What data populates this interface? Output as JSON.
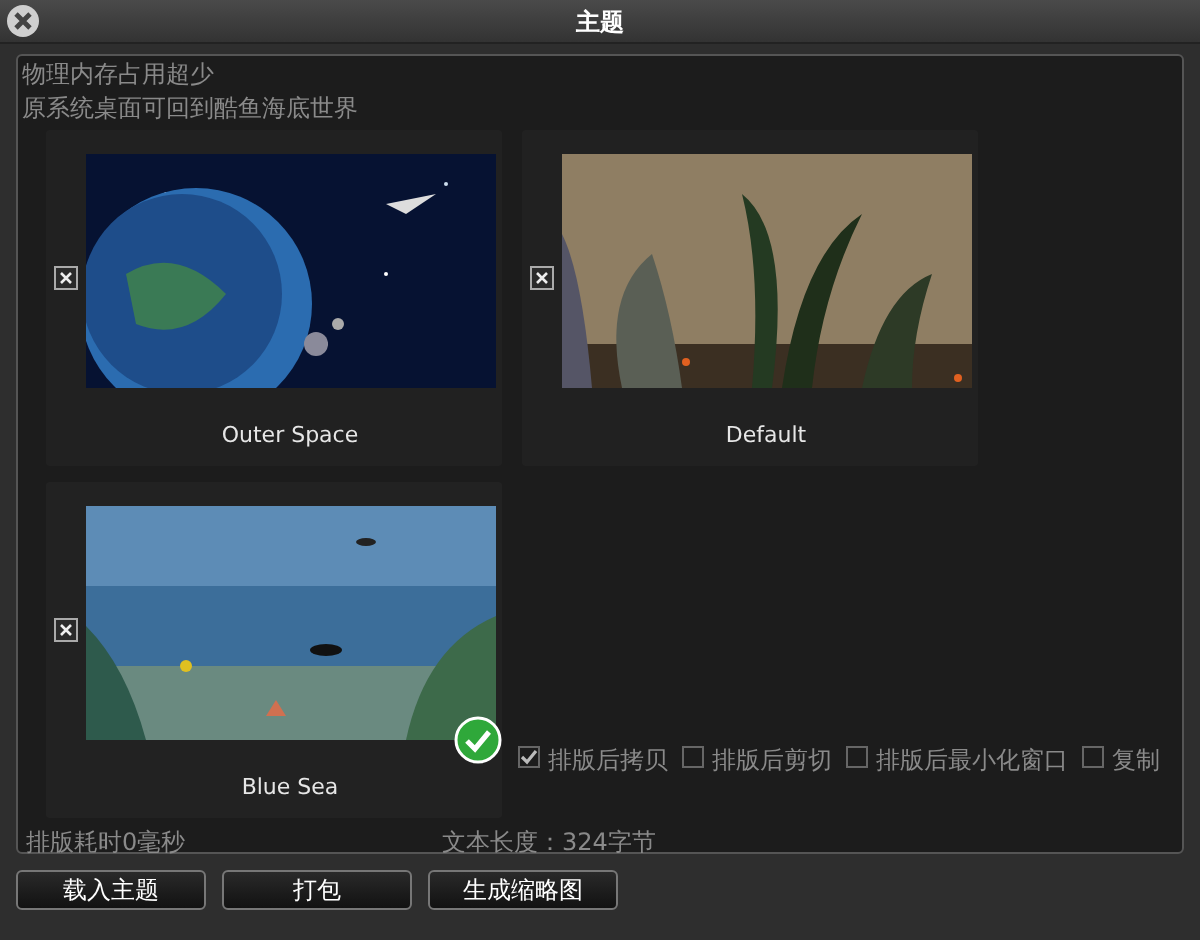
{
  "window": {
    "title": "主题"
  },
  "background_app": {
    "lines": [
      "物理内存占用超少",
      "原系统桌面可回到酷鱼海底世界"
    ],
    "options": [
      {
        "label": "排版后拷贝",
        "checked": true
      },
      {
        "label": "排版后剪切",
        "checked": false
      },
      {
        "label": "排版后最小化窗口",
        "checked": false
      },
      {
        "label": "复制",
        "checked": false
      }
    ],
    "status": [
      "排版耗时0毫秒",
      "文本长度：324字节"
    ]
  },
  "themes": [
    {
      "name": "Outer Space",
      "kind": "space",
      "selected": false
    },
    {
      "name": "Default",
      "kind": "aquarium",
      "selected": false
    },
    {
      "name": "Blue Sea",
      "kind": "sea",
      "selected": true
    }
  ],
  "buttons": [
    "载入主题",
    "打包",
    "生成缩略图"
  ]
}
